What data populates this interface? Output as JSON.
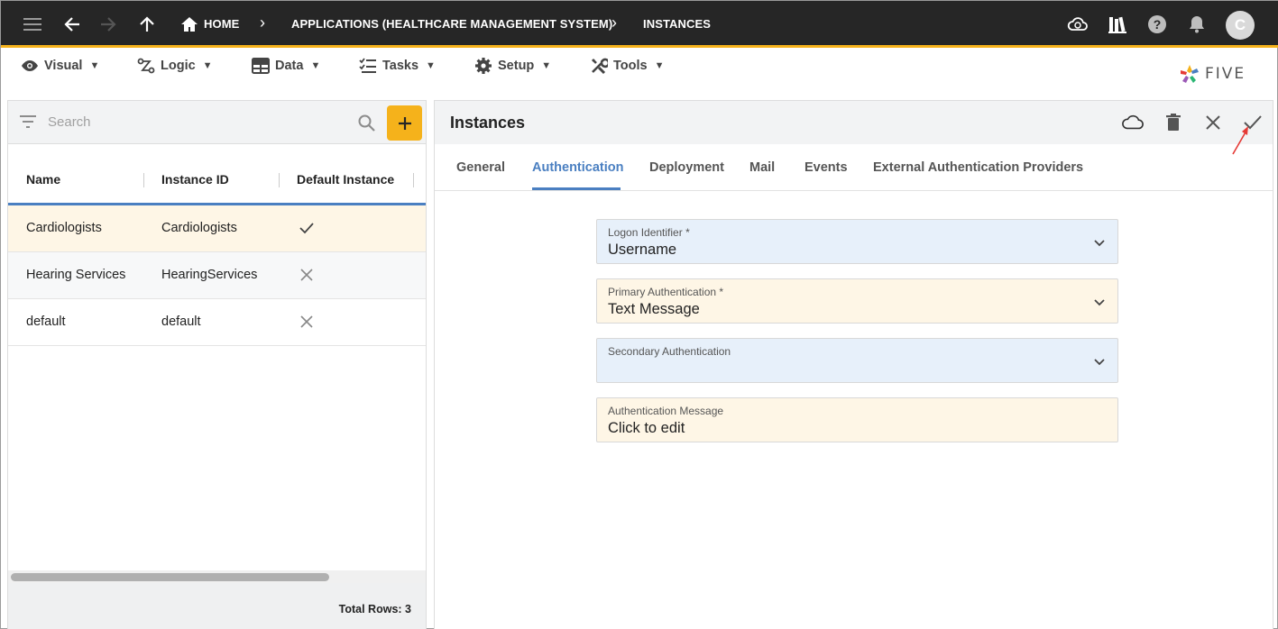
{
  "topbar": {
    "breadcrumbs": {
      "home": "HOME",
      "application": "APPLICATIONS (HEALTHCARE MANAGEMENT SYSTEM)",
      "current": "INSTANCES"
    },
    "avatar_initial": "C",
    "accent_color": "#f5b21b",
    "icons": [
      "menu-icon",
      "back-arrow-icon",
      "forward-arrow-icon",
      "up-arrow-icon",
      "home-icon",
      "cloud-sync-icon",
      "library-icon",
      "help-icon",
      "bell-icon"
    ]
  },
  "menubar": {
    "items": [
      {
        "label": "Visual",
        "icon": "eye-icon"
      },
      {
        "label": "Logic",
        "icon": "logic-icon"
      },
      {
        "label": "Data",
        "icon": "table-icon"
      },
      {
        "label": "Tasks",
        "icon": "tasks-icon"
      },
      {
        "label": "Setup",
        "icon": "gear-icon"
      },
      {
        "label": "Tools",
        "icon": "tools-icon"
      }
    ],
    "caret": "▼",
    "brand": "FIVE"
  },
  "list": {
    "search_placeholder": "Search",
    "columns": [
      "Name",
      "Instance ID",
      "Default Instance"
    ],
    "rows": [
      {
        "name": "Cardiologists",
        "instance_id": "Cardiologists",
        "default": true,
        "selected": true
      },
      {
        "name": "Hearing Services",
        "instance_id": "HearingServices",
        "default": false,
        "selected": false
      },
      {
        "name": "default",
        "instance_id": "default",
        "default": false,
        "selected": false
      }
    ],
    "total_rows": "Total Rows: 3"
  },
  "form": {
    "title": "Instances",
    "tabs": [
      "General",
      "Authentication",
      "Deployment",
      "Mail",
      "Events",
      "External Authentication Providers"
    ],
    "active_tab": "Authentication",
    "fields": [
      {
        "label": "Logon Identifier *",
        "value": "Username"
      },
      {
        "label": "Primary Authentication *",
        "value": "Text Message"
      },
      {
        "label": "Secondary Authentication",
        "value": ""
      },
      {
        "label": "Authentication Message",
        "value": "Click to edit"
      }
    ]
  }
}
